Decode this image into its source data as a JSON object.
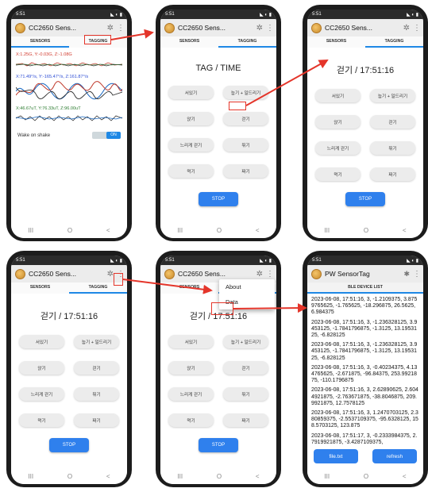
{
  "colors": {
    "arrow": "#e4352a",
    "accent": "#2f80ed",
    "tab_underline": "#1e88e5"
  },
  "status_time": "5:51",
  "app_title": "CC2650 Sens...",
  "tabs": {
    "sensors": "SENSORS",
    "tagging": "TAGGING"
  },
  "nav": {
    "recent": "III",
    "home": "O",
    "back": "<"
  },
  "sensor_screen": {
    "accel": "X:1.25G, Y:-0.03G, Z:-1.08G",
    "gyro": "X:71.49°/s, Y:-165.47°/s, Z:161.87°/s",
    "mag": "X:46.67uT, Y:76.33uT, Z:96.00uT",
    "wake_label": "Wake on shake",
    "toggle": "ON"
  },
  "tag_title_initial": "TAG / TIME",
  "tag_title_active": "걷기 / 17:51:16",
  "activities": [
    "서있기",
    "눕기 + 일드리기",
    "앉기",
    "걷기",
    "느리게 걷기",
    "뛰기",
    "먹기",
    "짜기"
  ],
  "stop_label": "STOP",
  "menu": {
    "about": "About",
    "data": "Data"
  },
  "data_screen": {
    "title": "PW SensorTag",
    "tab": "BLE DEVICE LIST",
    "records": [
      "2023-06-08, 17:51:16, 3, -1.2109375, 3.8759765625, -1.765625, -18.296875, 26.5625, 6.984375",
      "2023-06-08, 17:51:16, 3, -1.236328125, 3.9453125, -1.7841796875, -1.3125, 13.1953125, -6.828125",
      "2023-06-08, 17:51:16, 3, -1.236328125, 3.9453125, -1.7841796875, -1.3125, 13.1953125, -6.828125",
      "2023-06-08, 17:51:16, 3, -0.40234375, 4.134765625, -2.671875, -96.84375, 253.9921875, -110.1796875",
      "2023-06-08, 17:51:16, 3, 2.62890625, 2.6044921875, -2.763671875, -38.8046875, 209.9921875, 12.7578125",
      "2023-06-08, 17:51:16, 3, 1.2470703125, 2.380859375, -2.5537109375, -95.6328125, 158.5703125, 123.875",
      "2023-06-08, 17:51:17, 3, -0.2333984375, 2.7919921875, -3.4287109375,"
    ],
    "file_button": "file.txt",
    "refresh_button": "refresh"
  }
}
